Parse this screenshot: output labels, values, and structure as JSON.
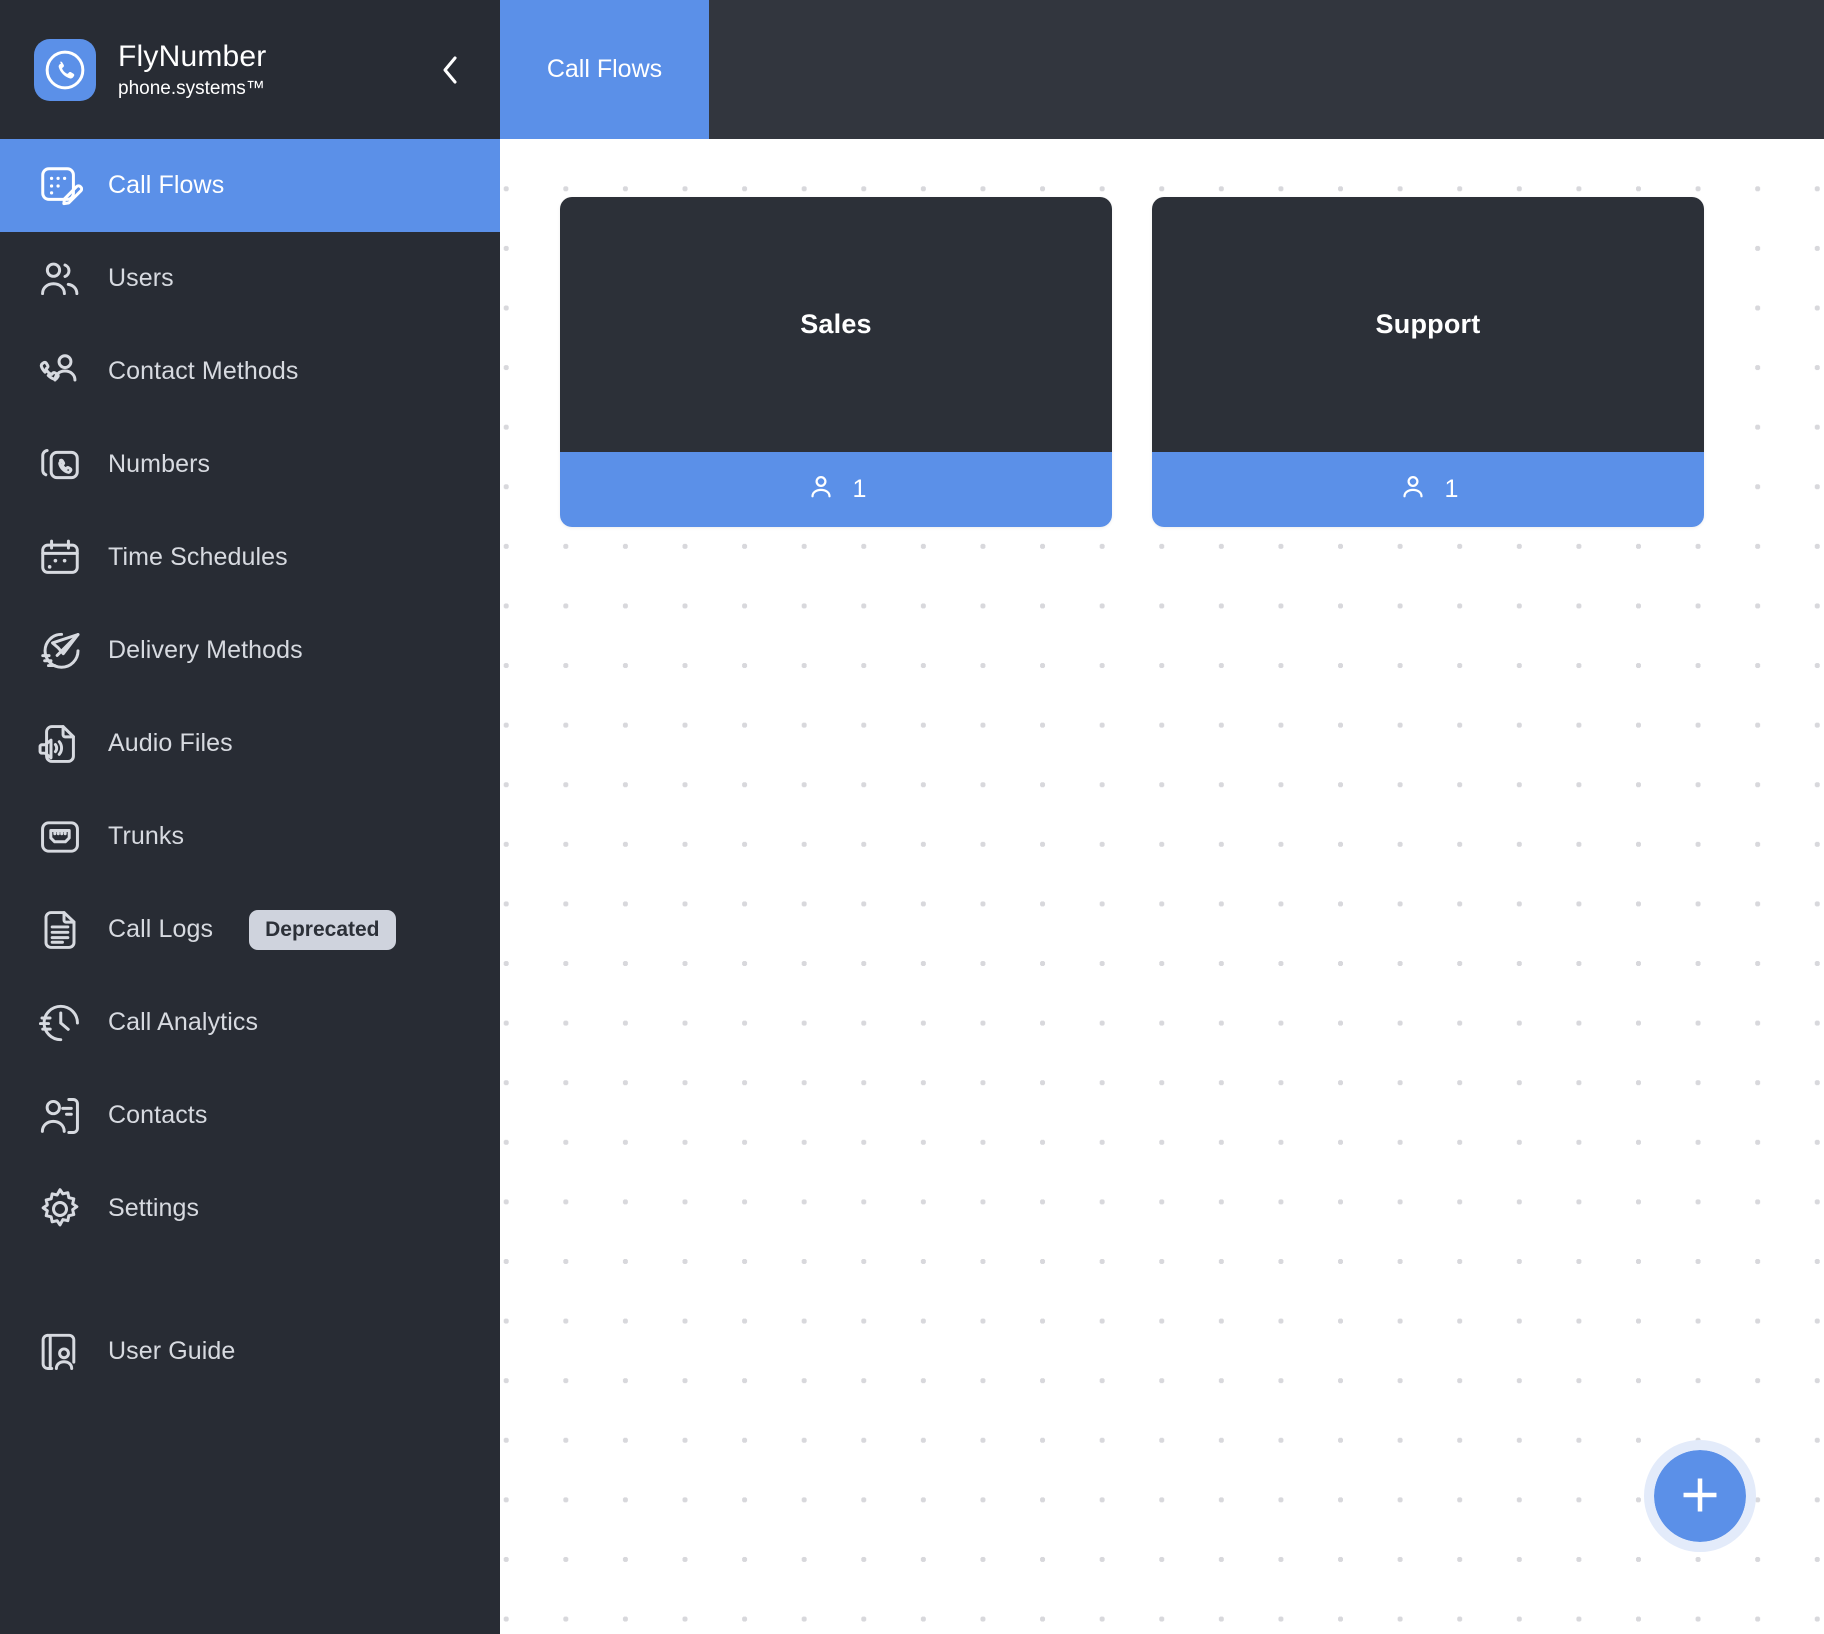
{
  "brand": {
    "title": "FlyNumber",
    "subtitle": "phone.systems™",
    "logo_icon": "phone-circle-icon",
    "collapse_icon": "chevron-left-icon"
  },
  "colors": {
    "accent": "#5b90e8",
    "sidebar_bg": "#282c34",
    "tabbar_bg": "#32363e",
    "card_bg": "#2c3038",
    "badge_bg": "#cfd3dd",
    "dot_grid": "#d8d8dc",
    "fab_ring": "#e3ebfa"
  },
  "sidebar": {
    "items": [
      {
        "label": "Call Flows",
        "icon": "call-flow-edit-icon",
        "active": true,
        "badge": null
      },
      {
        "label": "Users",
        "icon": "users-icon",
        "active": false,
        "badge": null
      },
      {
        "label": "Contact Methods",
        "icon": "phone-user-icon",
        "active": false,
        "badge": null
      },
      {
        "label": "Numbers",
        "icon": "phone-cards-icon",
        "active": false,
        "badge": null
      },
      {
        "label": "Time Schedules",
        "icon": "calendar-icon",
        "active": false,
        "badge": null
      },
      {
        "label": "Delivery Methods",
        "icon": "paper-plane-icon",
        "active": false,
        "badge": null
      },
      {
        "label": "Audio Files",
        "icon": "audio-file-icon",
        "active": false,
        "badge": null
      },
      {
        "label": "Trunks",
        "icon": "ethernet-port-icon",
        "active": false,
        "badge": null
      },
      {
        "label": "Call Logs",
        "icon": "document-lines-icon",
        "active": false,
        "badge": "Deprecated"
      },
      {
        "label": "Call Analytics",
        "icon": "clock-speed-icon",
        "active": false,
        "badge": null
      },
      {
        "label": "Contacts",
        "icon": "contact-card-icon",
        "active": false,
        "badge": null
      },
      {
        "label": "Settings",
        "icon": "gear-icon",
        "active": false,
        "badge": null
      }
    ],
    "footer_items": [
      {
        "label": "User Guide",
        "icon": "book-user-icon",
        "active": false,
        "badge": null
      }
    ]
  },
  "tabs": [
    {
      "label": "Call Flows",
      "active": true
    }
  ],
  "canvas": {
    "add_button_icon": "plus-icon",
    "add_button_label": "",
    "cards": [
      {
        "title": "Sales",
        "user_icon": "user-icon",
        "count": "1"
      },
      {
        "title": "Support",
        "user_icon": "user-icon",
        "count": "1"
      }
    ]
  }
}
